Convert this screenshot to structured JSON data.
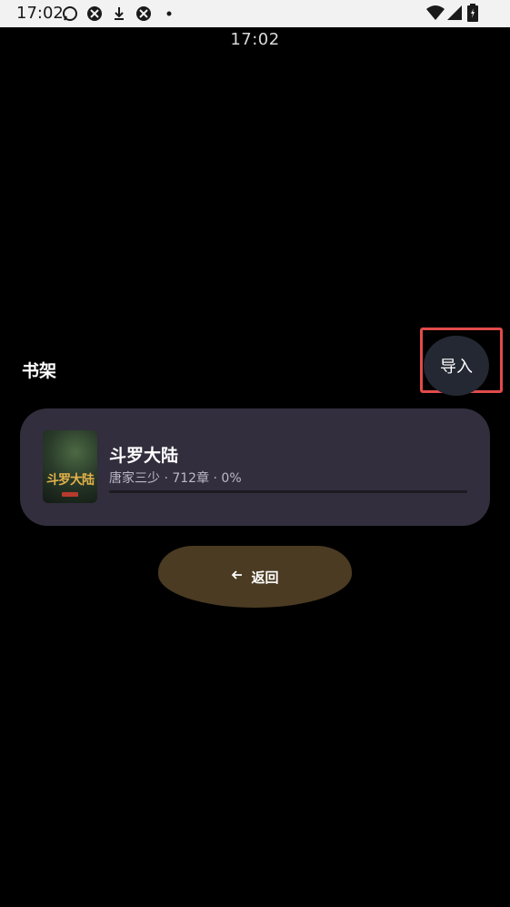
{
  "statusbar": {
    "time": "17:02",
    "icons_left": [
      "whatsapp-icon",
      "app-icon",
      "download-icon",
      "app-icon",
      "dot-icon"
    ],
    "icons_right": [
      "wifi-icon",
      "signal-icon",
      "battery-icon"
    ]
  },
  "clock": {
    "time": "17:02"
  },
  "shelf": {
    "title": "书架",
    "import_label": "导入"
  },
  "book": {
    "cover_text": "斗罗大陆",
    "title": "斗罗大陆",
    "meta": "唐家三少 · 712章 · 0%",
    "progress": 0
  },
  "nav": {
    "back_label": "返回"
  },
  "colors": {
    "background": "#000000",
    "card": "#322e3d",
    "import_button": "#242833",
    "back_button": "#4a3b22",
    "highlight": "#e24b4b"
  }
}
